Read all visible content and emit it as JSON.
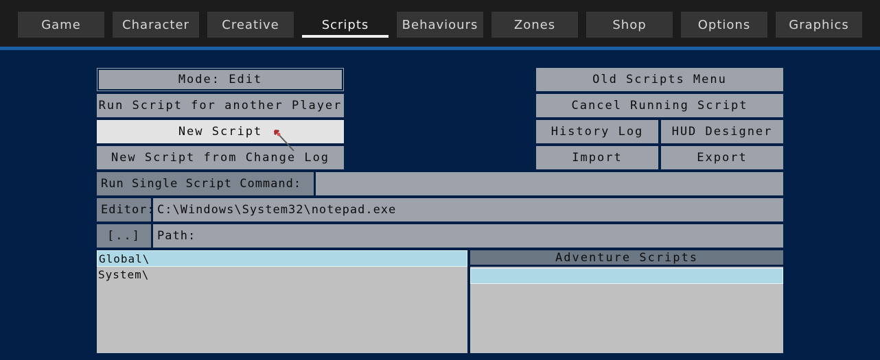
{
  "tabs": [
    {
      "label": "Game"
    },
    {
      "label": "Character"
    },
    {
      "label": "Creative"
    },
    {
      "label": "Scripts",
      "active": true
    },
    {
      "label": "Behaviours"
    },
    {
      "label": "Zones"
    },
    {
      "label": "Shop"
    },
    {
      "label": "Options"
    },
    {
      "label": "Graphics"
    }
  ],
  "left_buttons": {
    "mode": "Mode: Edit",
    "run_for_player": "Run Script for another Player",
    "new_script": "New Script",
    "new_from_log": "New Script from Change Log"
  },
  "right_buttons": {
    "old_menu": "Old Scripts Menu",
    "cancel_running": "Cancel Running Script",
    "history_log": "History Log",
    "hud_designer": "HUD Designer",
    "import": "Import",
    "export": "Export"
  },
  "command_row": {
    "label": "Run Single Script Command:",
    "value": ""
  },
  "editor_row": {
    "label": "Editor:",
    "value": "C:\\Windows\\System32\\notepad.exe"
  },
  "path_row": {
    "button": "[..]",
    "label": "Path:"
  },
  "left_list": {
    "items": [
      "Global\\",
      "System\\"
    ]
  },
  "right_panel": {
    "header": "Adventure Scripts"
  },
  "colors": {
    "background": "#022047",
    "accent_line": "#1a5fa8",
    "button": "#9ea2ab",
    "selection": "#add8e6"
  }
}
